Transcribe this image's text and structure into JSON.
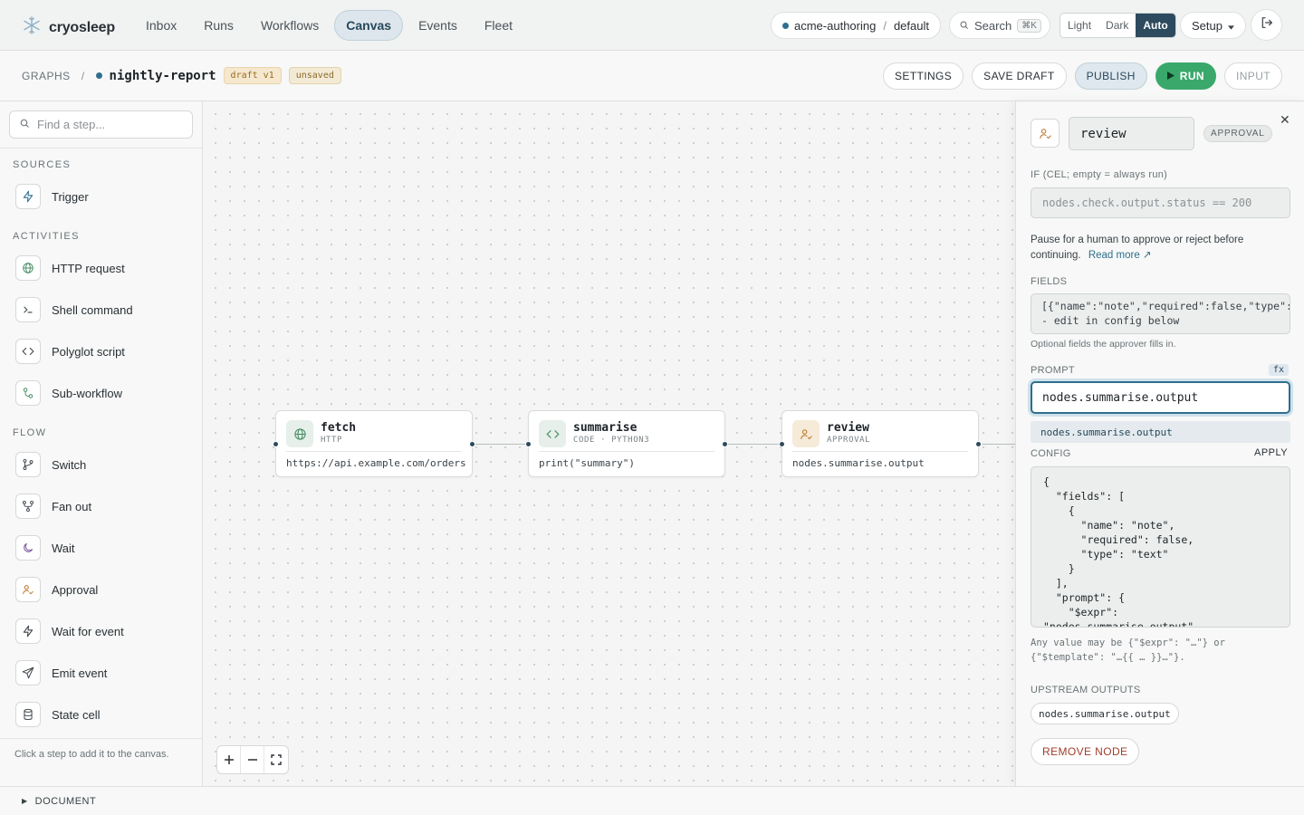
{
  "app": {
    "name": "cryosleep",
    "nav": [
      "Inbox",
      "Runs",
      "Workflows",
      "Canvas",
      "Events",
      "Fleet"
    ],
    "active_nav": "Canvas",
    "workspace": {
      "org": "acme-authoring",
      "separator": "/",
      "env": "default"
    },
    "search": {
      "label": "Search",
      "shortcut": "⌘K"
    },
    "theme": {
      "options": [
        "Light",
        "Dark",
        "Auto"
      ],
      "selected": "Auto"
    },
    "setup_label": "Setup",
    "accent": "#2e6f8e"
  },
  "graph": {
    "breadcrumb_root": "GRAPHS",
    "separator": "/",
    "name": "nightly-report",
    "version_tag": "draft v1",
    "state_tag": "unsaved",
    "actions": {
      "settings": "SETTINGS",
      "save_draft": "SAVE DRAFT",
      "publish": "PUBLISH",
      "run": "RUN",
      "input": "INPUT"
    }
  },
  "sidebar": {
    "search_placeholder": "Find a step...",
    "sections": [
      {
        "title": "SOURCES",
        "items": [
          {
            "label": "Trigger",
            "icon": "bolt-icon"
          }
        ]
      },
      {
        "title": "ACTIVITIES",
        "items": [
          {
            "label": "HTTP request",
            "icon": "globe-icon"
          },
          {
            "label": "Shell command",
            "icon": "terminal-icon"
          },
          {
            "label": "Polyglot script",
            "icon": "code-icon"
          },
          {
            "label": "Sub-workflow",
            "icon": "subflow-icon"
          }
        ]
      },
      {
        "title": "FLOW",
        "items": [
          {
            "label": "Switch",
            "icon": "branch-icon"
          },
          {
            "label": "Fan out",
            "icon": "fanout-icon"
          },
          {
            "label": "Wait",
            "icon": "moon-icon"
          },
          {
            "label": "Approval",
            "icon": "user-check-icon"
          },
          {
            "label": "Wait for event",
            "icon": "bolt-icon"
          },
          {
            "label": "Emit event",
            "icon": "send-icon"
          },
          {
            "label": "State cell",
            "icon": "database-icon"
          }
        ]
      }
    ],
    "footer_hint": "Click a step to add it to the canvas."
  },
  "nodes": [
    {
      "title": "fetch",
      "kind": "HTTP",
      "body": "https://api.example.com/orders",
      "icon": "globe-icon"
    },
    {
      "title": "summarise",
      "kind": "CODE · PYTHON3",
      "body": "print(\"summary\")",
      "icon": "code-icon"
    },
    {
      "title": "review",
      "kind": "APPROVAL",
      "body": "nodes.summarise.output",
      "icon": "user-check-icon"
    }
  ],
  "inspector": {
    "name": "review",
    "kind": "APPROVAL",
    "if_label": "IF (CEL; empty = always run)",
    "if_placeholder": "nodes.check.output.status == 200",
    "description": "Pause for a human to approve or reject before continuing.",
    "read_more": "Read more ↗",
    "fields_label": "FIELDS",
    "fields_line1": "[{\"name\":\"note\",\"required\":false,\"type\":\"text\"}]",
    "fields_line2": "- edit in config below",
    "fields_help": "Optional fields the approver fills in.",
    "prompt_label": "PROMPT",
    "fx": "fx",
    "prompt_value": "nodes.summarise.output",
    "suggestion": "nodes.summarise.output",
    "config_label": "CONFIG",
    "apply": "APPLY",
    "config_json": "{\n  \"fields\": [\n    {\n      \"name\": \"note\",\n      \"required\": false,\n      \"type\": \"text\"\n    }\n  ],\n  \"prompt\": {\n    \"$expr\":\n\"nodes.summarise.output\"\n  }\n}",
    "config_note": "Any value may be {\"$expr\": \"…\"} or {\"$template\": \"…{{ … }}…\"}.",
    "upstream_label": "UPSTREAM OUTPUTS",
    "upstream_chip": "nodes.summarise.output",
    "remove": "REMOVE NODE"
  },
  "bottom": {
    "label": "DOCUMENT"
  }
}
